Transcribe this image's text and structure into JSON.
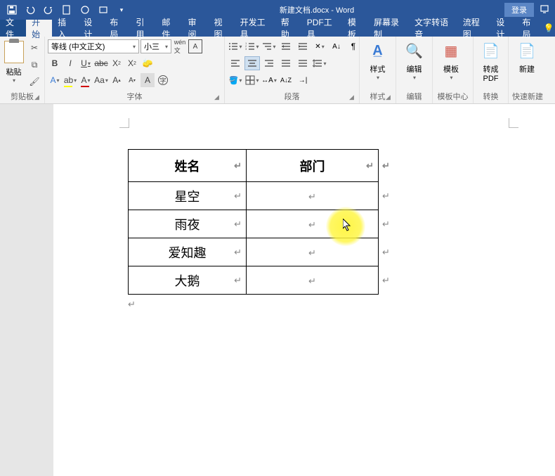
{
  "titlebar": {
    "doc_title": "新建文档.docx  -  Word",
    "login_label": "登录"
  },
  "tabs": {
    "file": "文件",
    "home": "开始",
    "insert": "插入",
    "design": "设计",
    "layout": "布局",
    "references": "引用",
    "mail": "邮件",
    "review": "审阅",
    "view": "视图",
    "dev": "开发工具",
    "help": "帮助",
    "pdf": "PDF工具",
    "templates": "模板",
    "screenrec": "屏幕录制",
    "tts": "文字转语音",
    "flowchart": "流程图",
    "table_design": "设计",
    "table_layout": "布局"
  },
  "ribbon": {
    "clipboard_label": "剪贴板",
    "paste_label": "粘贴",
    "font_group_label": "字体",
    "font_name": "等线 (中文正文)",
    "font_size": "小三",
    "paragraph_label": "段落",
    "styles_label": "样式",
    "styles_btn": "样式",
    "edit_label": "编辑",
    "edit_btn": "编辑",
    "template_center_label": "模板中心",
    "template_btn": "模板",
    "convert_label": "转换",
    "convert_btn_line1": "转成",
    "convert_btn_line2": "PDF",
    "quick_new_label": "快速新建",
    "quick_new_btn": "新建"
  },
  "table": {
    "headers": {
      "name": "姓名",
      "dept": "部门"
    },
    "rows": [
      {
        "name": "星空",
        "dept": ""
      },
      {
        "name": "雨夜",
        "dept": ""
      },
      {
        "name": "爱知趣",
        "dept": ""
      },
      {
        "name": "大鹅",
        "dept": ""
      }
    ]
  }
}
